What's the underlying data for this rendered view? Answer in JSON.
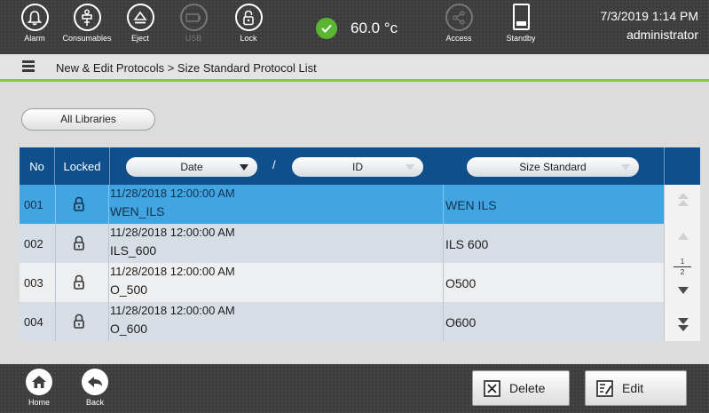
{
  "topbar": {
    "buttons": [
      {
        "label": "Alarm",
        "icon": "bell-icon",
        "enabled": true
      },
      {
        "label": "Consumables",
        "icon": "consumables-icon",
        "enabled": true
      },
      {
        "label": "Eject",
        "icon": "eject-icon",
        "enabled": true
      },
      {
        "label": "USB",
        "icon": "usb-icon",
        "enabled": false
      },
      {
        "label": "Lock",
        "icon": "lock-icon",
        "enabled": true
      }
    ],
    "temperature": {
      "value": "60.0",
      "unit": "°c",
      "status": "ok",
      "status_color": "#5cb531"
    },
    "access": {
      "label": "Access",
      "icon": "share-icon",
      "enabled": false
    },
    "standby": {
      "label": "Standby",
      "icon": "standby-icon"
    },
    "datetime": "7/3/2019 1:14 PM",
    "user": "administrator"
  },
  "breadcrumb": {
    "text": "New & Edit Protocols > Size Standard Protocol List",
    "accent_color": "#8cc63f"
  },
  "library_filter": {
    "label": "All Libraries"
  },
  "table": {
    "header_color": "#0f4f8c",
    "selected_color": "#41a5e2",
    "columns": {
      "no": "No",
      "locked": "Locked",
      "date": "Date",
      "separator": "/",
      "id": "ID",
      "size_standard": "Size Standard"
    },
    "rows": [
      {
        "no": "001",
        "date": "11/28/2018 12:00:00 AM",
        "id": "WEN_ILS",
        "size_standard": "WEN ILS",
        "locked": true,
        "selected": true
      },
      {
        "no": "002",
        "date": "11/28/2018 12:00:00 AM",
        "id": "ILS_600",
        "size_standard": "ILS 600",
        "locked": true,
        "selected": false
      },
      {
        "no": "003",
        "date": "11/28/2018 12:00:00 AM",
        "id": "O_500",
        "size_standard": "O500",
        "locked": true,
        "selected": false
      },
      {
        "no": "004",
        "date": "11/28/2018 12:00:00 AM",
        "id": "O_600",
        "size_standard": "O600",
        "locked": true,
        "selected": false
      }
    ],
    "pager": {
      "current": "1",
      "total": "2"
    }
  },
  "bottombar": {
    "home_label": "Home",
    "back_label": "Back",
    "delete_label": "Delete",
    "edit_label": "Edit"
  }
}
